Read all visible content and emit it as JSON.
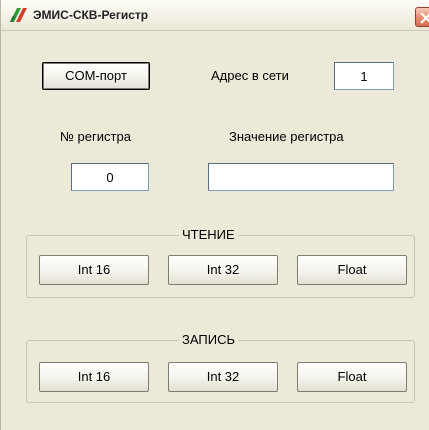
{
  "window": {
    "title": "ЭМИС-СКВ-Регистр"
  },
  "top": {
    "com_button_label": "COM-порт",
    "address_label": "Адрес в сети",
    "address_value": "1"
  },
  "register": {
    "number_label": "№  регистра",
    "number_value": "0",
    "value_label": "Значение регистра",
    "value_value": ""
  },
  "read_group": {
    "caption": "ЧТЕНИЕ",
    "buttons": [
      "Int 16",
      "Int 32",
      "Float"
    ]
  },
  "write_group": {
    "caption": "ЗАПИСЬ",
    "buttons": [
      "Int 16",
      "Int 32",
      "Float"
    ]
  },
  "colors": {
    "window_bg": "#ece9d8",
    "close_button": "#d66b4e",
    "icon_green": "#2e9a3a",
    "icon_red": "#d23a2a"
  }
}
